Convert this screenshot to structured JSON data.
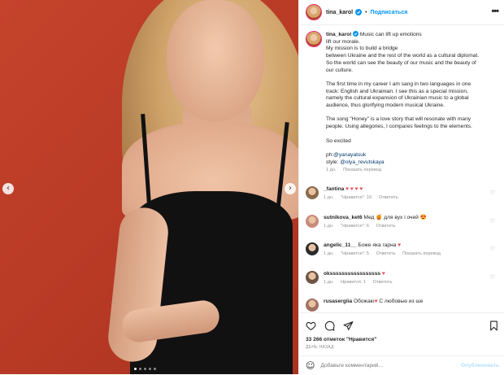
{
  "header": {
    "username": "tina_karol",
    "separator": "•",
    "follow_label": "Подписаться",
    "more": "•••"
  },
  "media": {
    "dots_total": 5,
    "dots_active": 1,
    "prev": "‹",
    "next": "›"
  },
  "caption": {
    "username": "tina_karol",
    "lines": [
      "Music can lift up emotions",
      "lift our morale.",
      "My mission is to build a bridge",
      "between Ukraine and the rest of the world as a cultural diplomat.",
      "So the world can see the beauty of our music and the beauty of",
      "our culture.",
      "",
      "The first time in my career I am sang in two languages in one",
      "track: English and Ukrainian. I see this as a special mission,",
      "namely the cultural expansion of Ukrainian music to a global",
      "audience, thus glorifying modern musical Ukraine.",
      "",
      "The song \"Honey\" is a love story that will resonate with many",
      "people. Using allegories, I compares feelings to the elements.",
      "",
      "So excited",
      ""
    ],
    "credit_ph_prefix": "ph:",
    "credit_ph_handle": "@yanayatsuk",
    "credit_style_prefix": "style: ",
    "credit_style_handle": "@olya_revutskaya",
    "time": "1 дн.",
    "translate": "Показать перевод"
  },
  "comments": [
    {
      "user": "_fantina",
      "text": "♥ ♥ ♥ ♥",
      "time": "1 дн.",
      "likes": "\"Нравится\": 10",
      "reply": "Ответить",
      "avatar_color": "#8a6a4a"
    },
    {
      "user": "sutnikova_ket6",
      "text": "Мед 🍯 для вух і очей 😍",
      "time": "1 дн.",
      "likes": "\"Нравится\": 6",
      "reply": "Ответить",
      "avatar_color": "#c98a7a"
    },
    {
      "user": "angelic_11__",
      "text": "Боже яка гарна ♥",
      "time": "1 дн.",
      "likes": "\"Нравится\": 5",
      "reply": "Ответить",
      "translate": "Показать перевод",
      "avatar_color": "#2b2b2b"
    },
    {
      "user": "oksssssssssssssssss",
      "text": "♥",
      "time": "1 дн.",
      "likes": "Нравится: 1",
      "reply": "Ответить",
      "avatar_color": "#6e5444"
    },
    {
      "user": "rusasergiia",
      "text": "Обожаю♥  С любовью из ше",
      "time": "",
      "likes": "",
      "reply": "",
      "avatar_color": "#a07060"
    }
  ],
  "actions": {
    "likes": "33 266 отметок \"Нравится\"",
    "ago": "ДЕНЬ НАЗАД"
  },
  "add_comment": {
    "emoji": "☺",
    "placeholder": "Добавьте комментарий...",
    "publish": "Опубликовать"
  },
  "colors": {
    "accent": "#0095f6",
    "heart": "#ed4956",
    "link": "#00376b",
    "meta": "#8e8e8e",
    "photo_bg": "#b83a25"
  },
  "icons": [
    "heart-icon",
    "comment-icon",
    "share-icon",
    "bookmark-icon",
    "verified-icon",
    "emoji-icon"
  ]
}
